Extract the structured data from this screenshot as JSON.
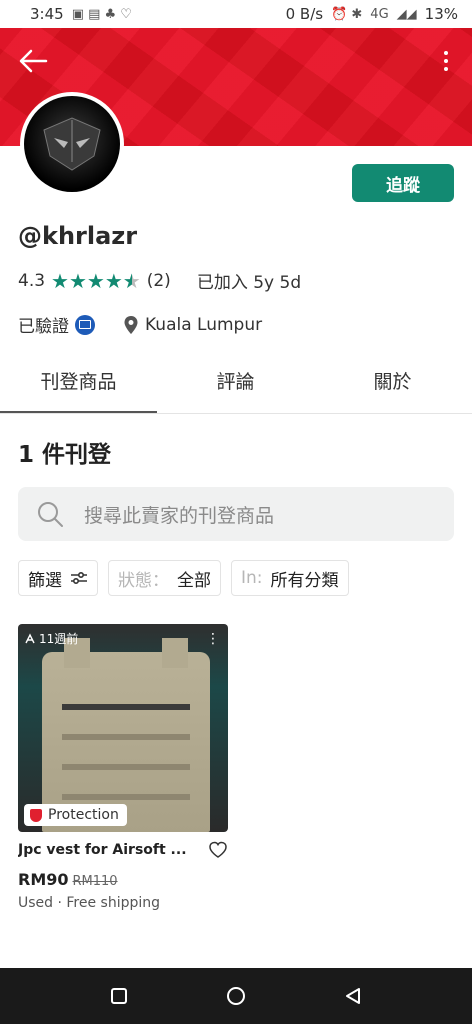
{
  "status_bar": {
    "time": "3:45",
    "net_speed": "0 B/s",
    "network": "4G",
    "battery": "13%"
  },
  "profile": {
    "username": "@khrlazr",
    "rating": "4.3",
    "rating_count": "(2)",
    "joined": "已加入 5y 5d",
    "verified_label": "已驗證",
    "location": "Kuala Lumpur",
    "follow_label": "追蹤"
  },
  "tabs": [
    {
      "label": "刊登商品"
    },
    {
      "label": "評論"
    },
    {
      "label": "關於"
    }
  ],
  "listings_count_title": "1 件刊登",
  "search": {
    "placeholder": "搜尋此賣家的刊登商品"
  },
  "filters": {
    "filter_label": "篩選",
    "status_key": "狀態：",
    "status_value": "全部",
    "category_key": "In:",
    "category_value": "所有分類"
  },
  "listing": {
    "time_ago": "11週前",
    "badge": "Protection",
    "title": "Jpc vest for Airsoft ...",
    "price": "RM90",
    "old_price": "RM110",
    "meta": "Used · Free shipping"
  },
  "colors": {
    "accent": "#128a72",
    "banner": "#e8162a",
    "star": "#128a72"
  }
}
